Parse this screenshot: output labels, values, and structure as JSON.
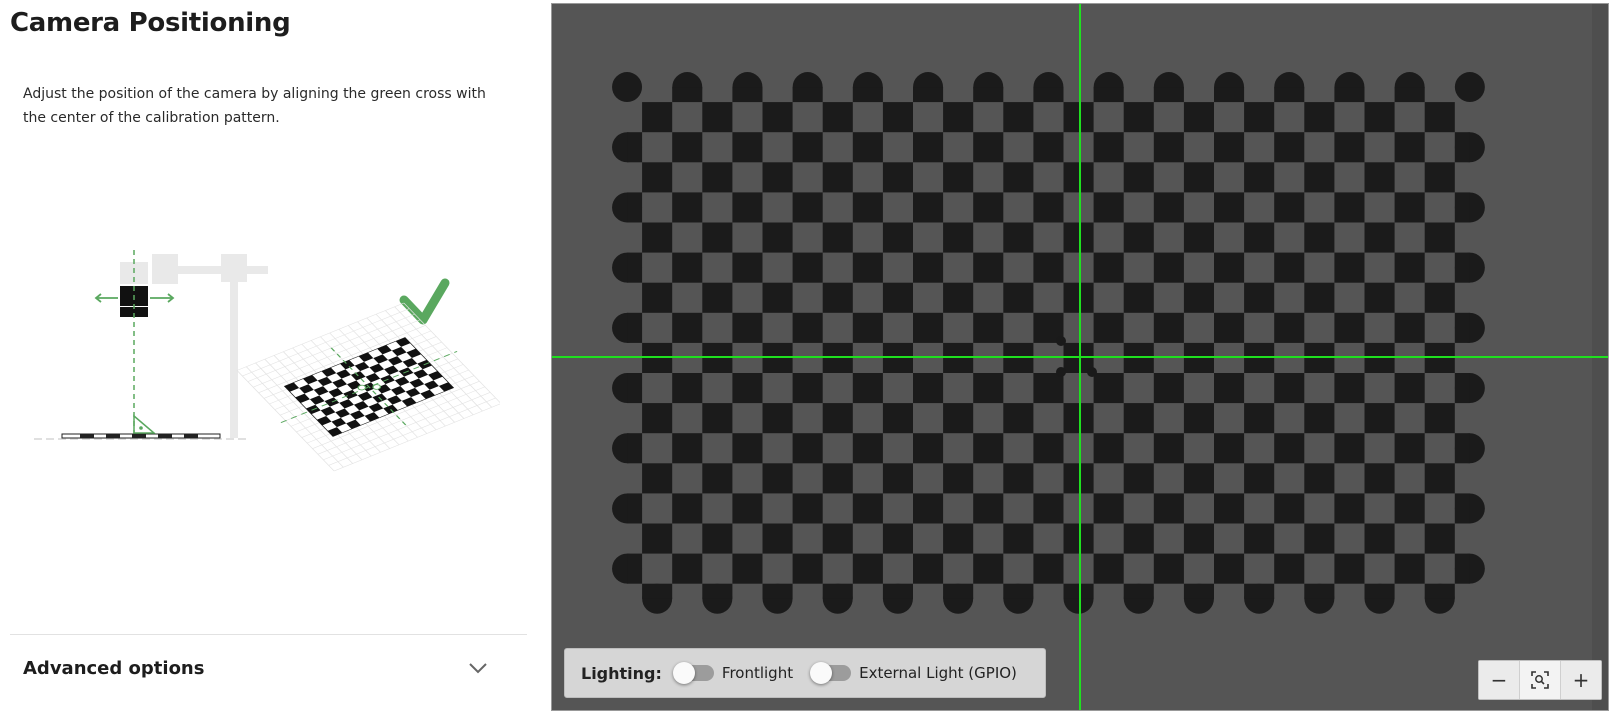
{
  "page": {
    "title": "Camera Positioning",
    "instruction": "Adjust the position of the camera by aligning the green cross with the center of the calibration pattern."
  },
  "advanced_options": {
    "label": "Advanced options",
    "icon": "chevron-down-icon"
  },
  "lighting": {
    "label": "Lighting:",
    "toggles": [
      {
        "label": "Frontlight",
        "on": false
      },
      {
        "label": "External Light (GPIO)",
        "on": false
      }
    ]
  },
  "zoom": {
    "out_symbol": "−",
    "fit_icon": "zoom-fit-icon",
    "in_symbol": "+"
  },
  "colors": {
    "crosshair": "#1fe01f",
    "accent_green": "#5aa85f",
    "image_background": "#555555"
  }
}
